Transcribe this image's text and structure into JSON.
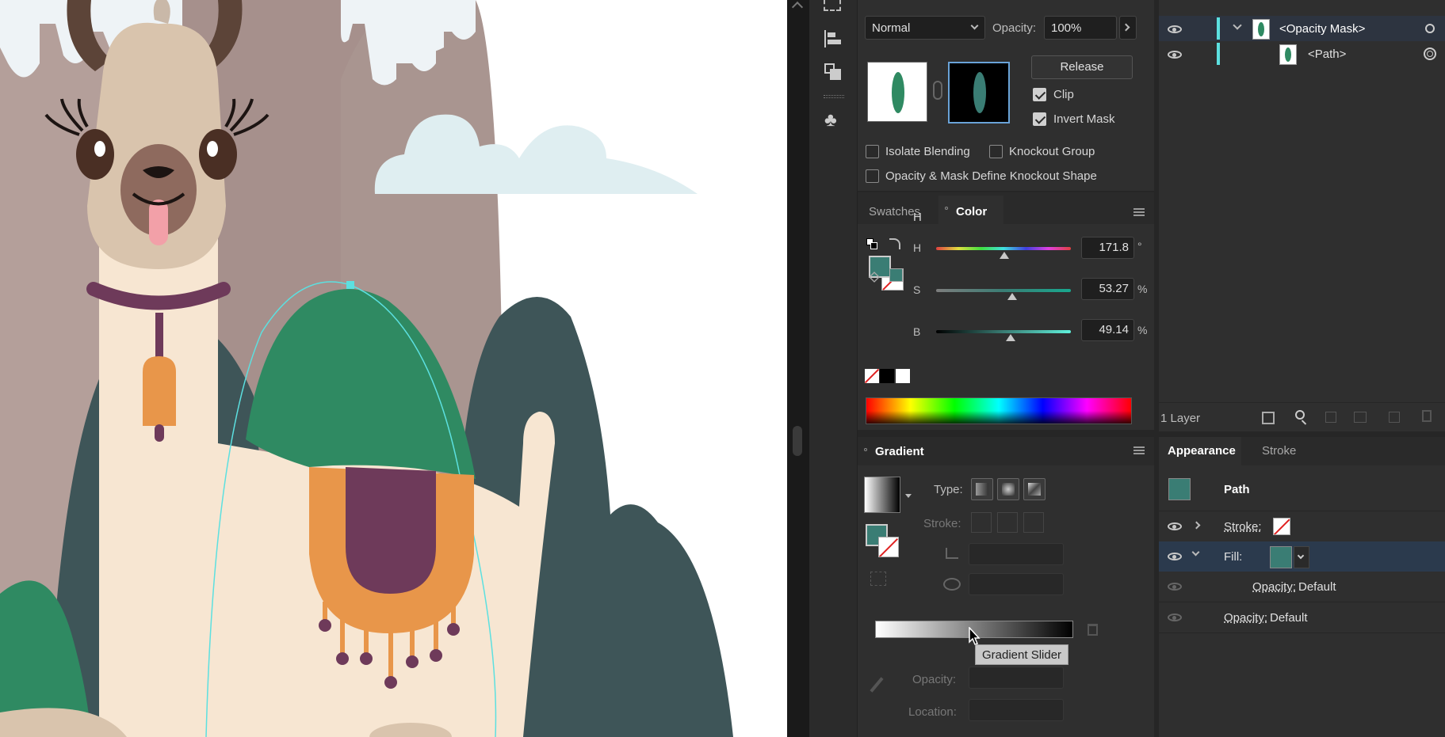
{
  "transparency": {
    "blend_mode": "Normal",
    "opacity_label": "Opacity:",
    "opacity_value": "100%",
    "release_label": "Release",
    "clip_label": "Clip",
    "invert_mask_label": "Invert Mask",
    "isolate_blending_label": "Isolate Blending",
    "knockout_group_label": "Knockout Group",
    "define_knockout_label": "Opacity & Mask Define Knockout Shape"
  },
  "color_panel": {
    "tabs": [
      "Swatches",
      "Color"
    ],
    "active_tab": "Color",
    "h_label": "H",
    "h_value": "171.8",
    "h_unit": "°",
    "s_label": "S",
    "s_value": "53.27",
    "s_unit": "%",
    "b_label": "B",
    "b_value": "49.14",
    "b_unit": "%",
    "fill_color": "#3a7d74"
  },
  "gradient_panel": {
    "title": "Gradient",
    "type_label": "Type:",
    "stroke_label": "Stroke:",
    "opacity_label": "Opacity:",
    "location_label": "Location:",
    "tooltip": "Gradient Slider"
  },
  "layers_panel": {
    "rows": [
      {
        "name": "<Opacity Mask>"
      },
      {
        "name": "<Path>"
      }
    ],
    "count_label": "1 Layer"
  },
  "appearance_panel": {
    "tabs": [
      "Appearance",
      "Stroke"
    ],
    "active_tab": "Appearance",
    "object_label": "Path",
    "stroke_label": "Stroke:",
    "fill_label": "Fill:",
    "fill_opacity_label": "Opacity:",
    "fill_opacity_value": "Default",
    "opacity_label": "Opacity:",
    "opacity_value": "Default"
  },
  "colors": {
    "accent_cyan": "#5ce0e0",
    "mask_green": "#2f8a62",
    "selection_blue": "#2b3a4d"
  }
}
